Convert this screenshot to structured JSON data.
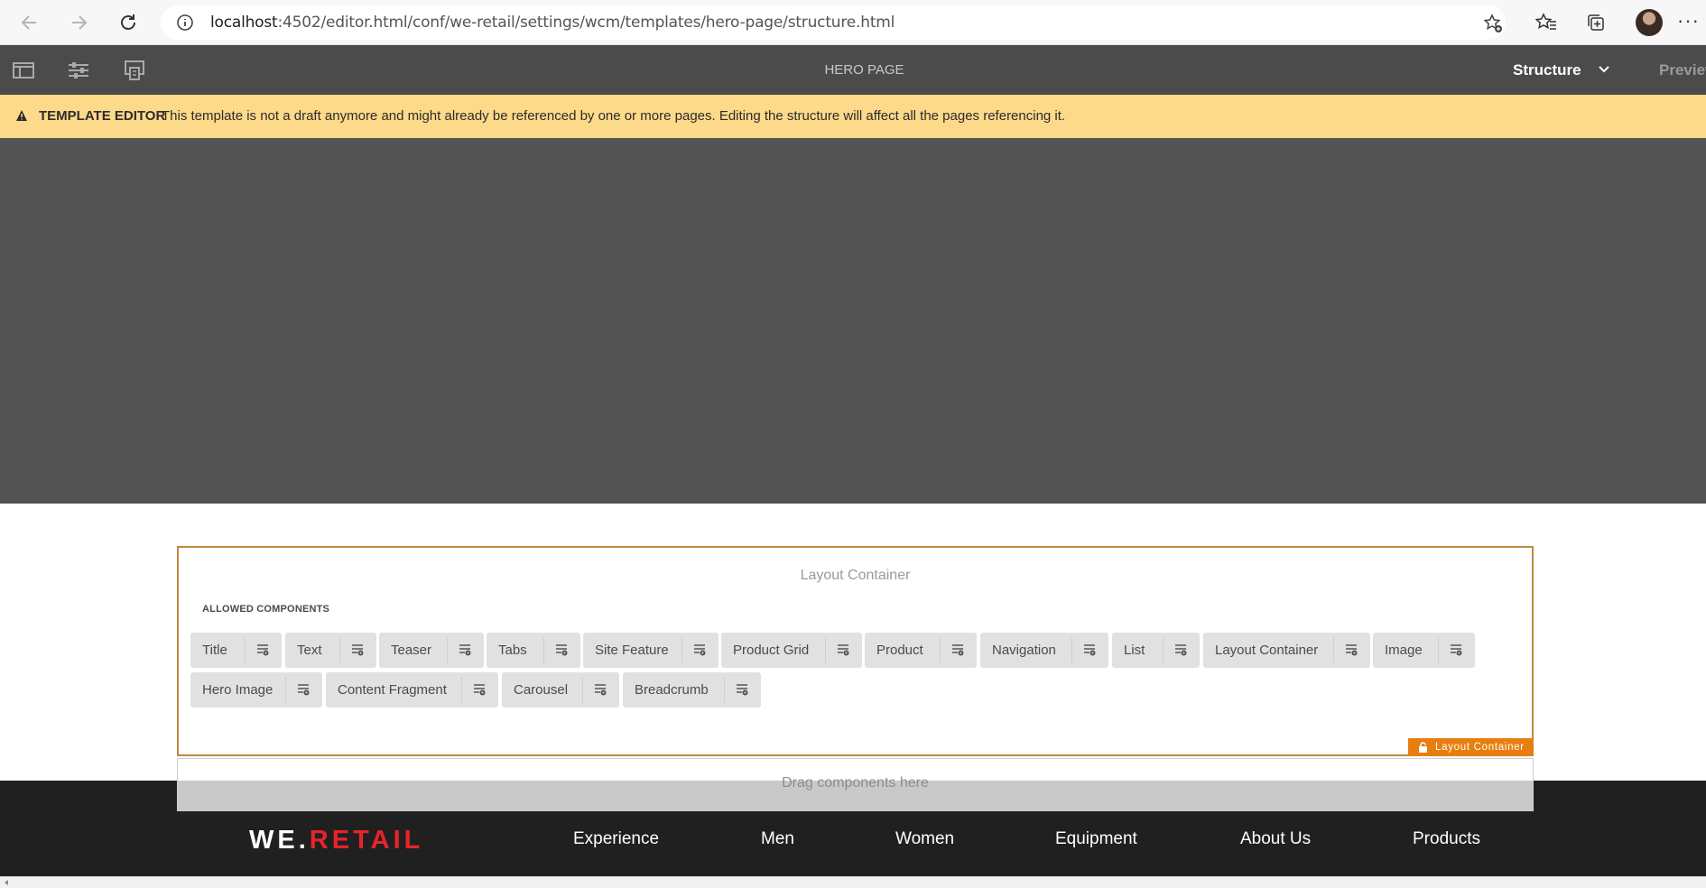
{
  "browser": {
    "url_host": "localhost",
    "url_path": ":4502/editor.html/conf/we-retail/settings/wcm/templates/hero-page/structure.html"
  },
  "editor": {
    "page_name": "HERO PAGE",
    "mode": "Structure",
    "preview": "Preview"
  },
  "banner": {
    "title": "TEMPLATE EDITOR",
    "message": "This template is not a draft anymore and might already be referenced by one or more pages. Editing the structure will affect all the pages referencing it."
  },
  "layout_container": {
    "title": "Layout Container",
    "allowed_heading": "ALLOWED COMPONENTS",
    "components": [
      "Title",
      "Text",
      "Teaser",
      "Tabs",
      "Site Feature",
      "Product Grid",
      "Product",
      "Navigation",
      "List",
      "Layout Container",
      "Image",
      "Hero Image",
      "Content Fragment",
      "Carousel",
      "Breadcrumb"
    ],
    "tag": "Layout Container",
    "drag_hint": "Drag components here"
  },
  "footer": {
    "logo_white": "WE.",
    "logo_red": "RETAIL",
    "nav": [
      "Experience",
      "Men",
      "Women",
      "Equipment",
      "About Us",
      "Products"
    ]
  },
  "colors": {
    "banner": "#fdd98a",
    "container_border": "#c3873f",
    "tag": "#e87e10",
    "logo_red": "#e5252a"
  }
}
